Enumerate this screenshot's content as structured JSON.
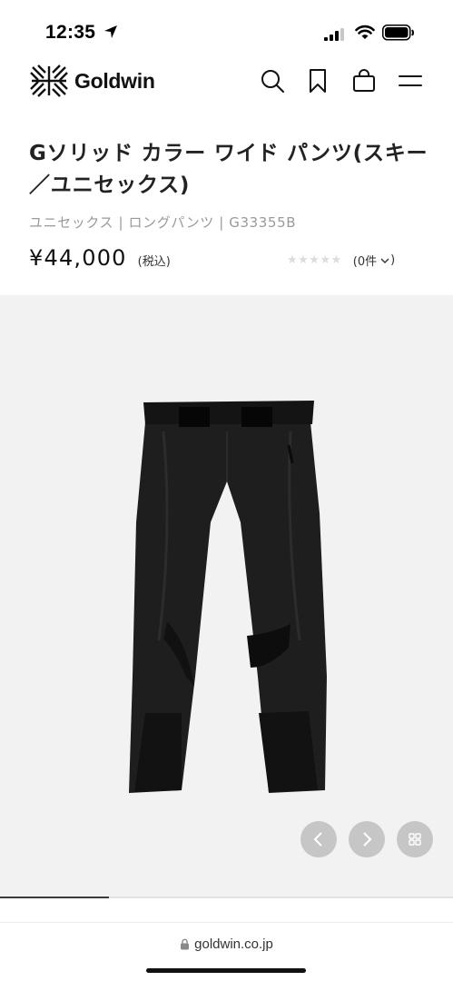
{
  "status_bar": {
    "time": "12:35"
  },
  "header": {
    "brand": "Goldwin",
    "icons": [
      "search-icon",
      "bookmark-icon",
      "cart-icon",
      "menu-icon"
    ]
  },
  "product": {
    "title": "Gソリッド カラー ワイド パンツ(スキー／ユニセックス)",
    "meta": "ユニセックス | ロングパンツ | G33355B",
    "price": "¥44,000",
    "tax_label": "(税込)",
    "rating_stars": "★★★★★",
    "rating_value": 0,
    "review_count_label": "(0件"
  },
  "gallery": {
    "progress_fraction": 0.24,
    "prev_icon": "chevron-left-icon",
    "next_icon": "chevron-right-icon",
    "grid_icon": "grid-icon"
  },
  "browser": {
    "url": "goldwin.co.jp"
  },
  "colors": {
    "gallery_bg": "#f2f2f2",
    "button_bg": "#c6c6c6",
    "meta_text": "#9a9a9a"
  }
}
